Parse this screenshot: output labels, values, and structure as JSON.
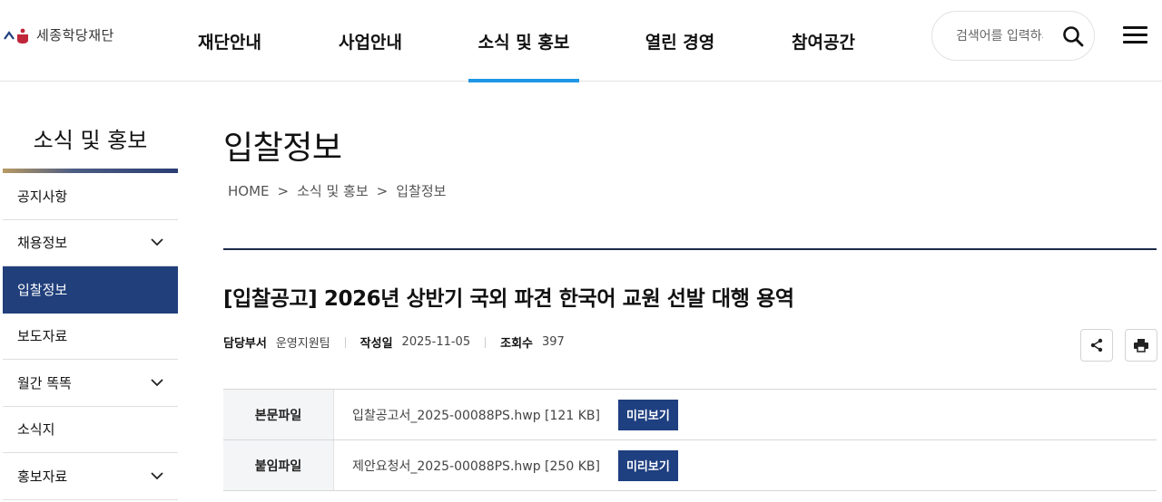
{
  "header": {
    "logo_text": "세종학당재단",
    "nav": [
      {
        "label": "재단안내",
        "active": false
      },
      {
        "label": "사업안내",
        "active": false
      },
      {
        "label": "소식 및 홍보",
        "active": true
      },
      {
        "label": "열린 경영",
        "active": false
      },
      {
        "label": "참여공간",
        "active": false
      }
    ],
    "search_placeholder": "검색어를 입력하세요",
    "accent_color": "#1f96e6"
  },
  "sidebar": {
    "title": "소식 및 홍보",
    "items": [
      {
        "label": "공지사항",
        "expandable": false,
        "active": false
      },
      {
        "label": "채용정보",
        "expandable": true,
        "active": false
      },
      {
        "label": "입찰정보",
        "expandable": false,
        "active": true
      },
      {
        "label": "보도자료",
        "expandable": false,
        "active": false
      },
      {
        "label": "월간 똑똑",
        "expandable": true,
        "active": false
      },
      {
        "label": "소식지",
        "expandable": false,
        "active": false
      },
      {
        "label": "홍보자료",
        "expandable": true,
        "active": false
      }
    ],
    "active_color": "#213f7b"
  },
  "content": {
    "page_title": "입찰정보",
    "breadcrumb": [
      "HOME",
      "소식 및 홍보",
      "입찰정보"
    ],
    "post_title": "[입찰공고] 2026년 상반기 국외 파견 한국어 교원 선발 대행 용역",
    "meta": [
      {
        "key": "담당부서",
        "value": "운영지원팀"
      },
      {
        "key": "작성일",
        "value": "2025-11-05"
      },
      {
        "key": "조회수",
        "value": "397"
      }
    ],
    "files": [
      {
        "head": "본문파일",
        "name": "입찰공고서_2025-00088PS.hwp [121 KB]",
        "button": "미리보기"
      },
      {
        "head": "붙임파일",
        "name": "제안요청서_2025-00088PS.hwp [250 KB]",
        "button": "미리보기"
      }
    ],
    "button_color": "#1e3f80"
  }
}
